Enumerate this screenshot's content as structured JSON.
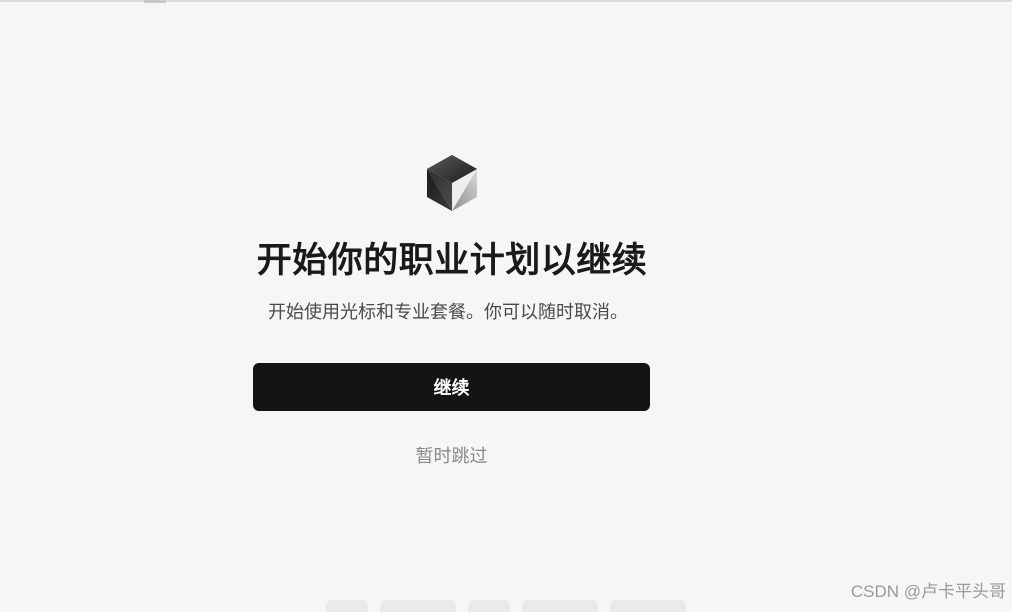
{
  "dialog": {
    "title": "开始你的职业计划以继续",
    "subtitle": "开始使用光标和专业套餐。你可以随时取消。",
    "continue_label": "继续",
    "skip_label": "暂时跳过",
    "logo_icon": "cube-logo-icon"
  },
  "watermark": {
    "text": "CSDN @卢卡平头哥"
  },
  "colors": {
    "background": "#f6f6f6",
    "button_bg": "#141414",
    "button_text": "#ffffff",
    "title": "#1a1a1a",
    "subtitle": "#4a4a4a",
    "skip": "#8a8a8a"
  }
}
